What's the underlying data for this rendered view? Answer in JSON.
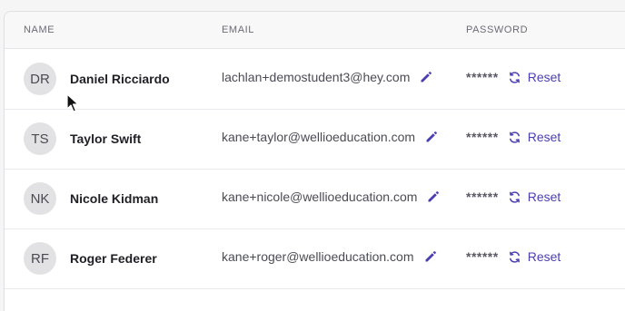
{
  "table": {
    "headers": {
      "name": "NAME",
      "email": "EMAIL",
      "password": "PASSWORD"
    },
    "rows": [
      {
        "initials": "DR",
        "name": "Daniel Ricciardo",
        "email": "lachlan+demostudent3@hey.com",
        "password": "******",
        "reset_label": "Reset"
      },
      {
        "initials": "TS",
        "name": "Taylor Swift",
        "email": "kane+taylor@wellioeducation.com",
        "password": "******",
        "reset_label": "Reset"
      },
      {
        "initials": "NK",
        "name": "Nicole Kidman",
        "email": "kane+nicole@wellioeducation.com",
        "password": "******",
        "reset_label": "Reset"
      },
      {
        "initials": "RF",
        "name": "Roger Federer",
        "email": "kane+roger@wellioeducation.com",
        "password": "******",
        "reset_label": "Reset"
      }
    ]
  },
  "icons": {
    "edit": "pencil-icon",
    "reset": "refresh-icon",
    "pointer": "mouse-cursor-icon"
  },
  "colors": {
    "accent": "#4b3fb0",
    "avatar_bg": "#e2e2e4",
    "header_bg": "#f8f8f9"
  }
}
